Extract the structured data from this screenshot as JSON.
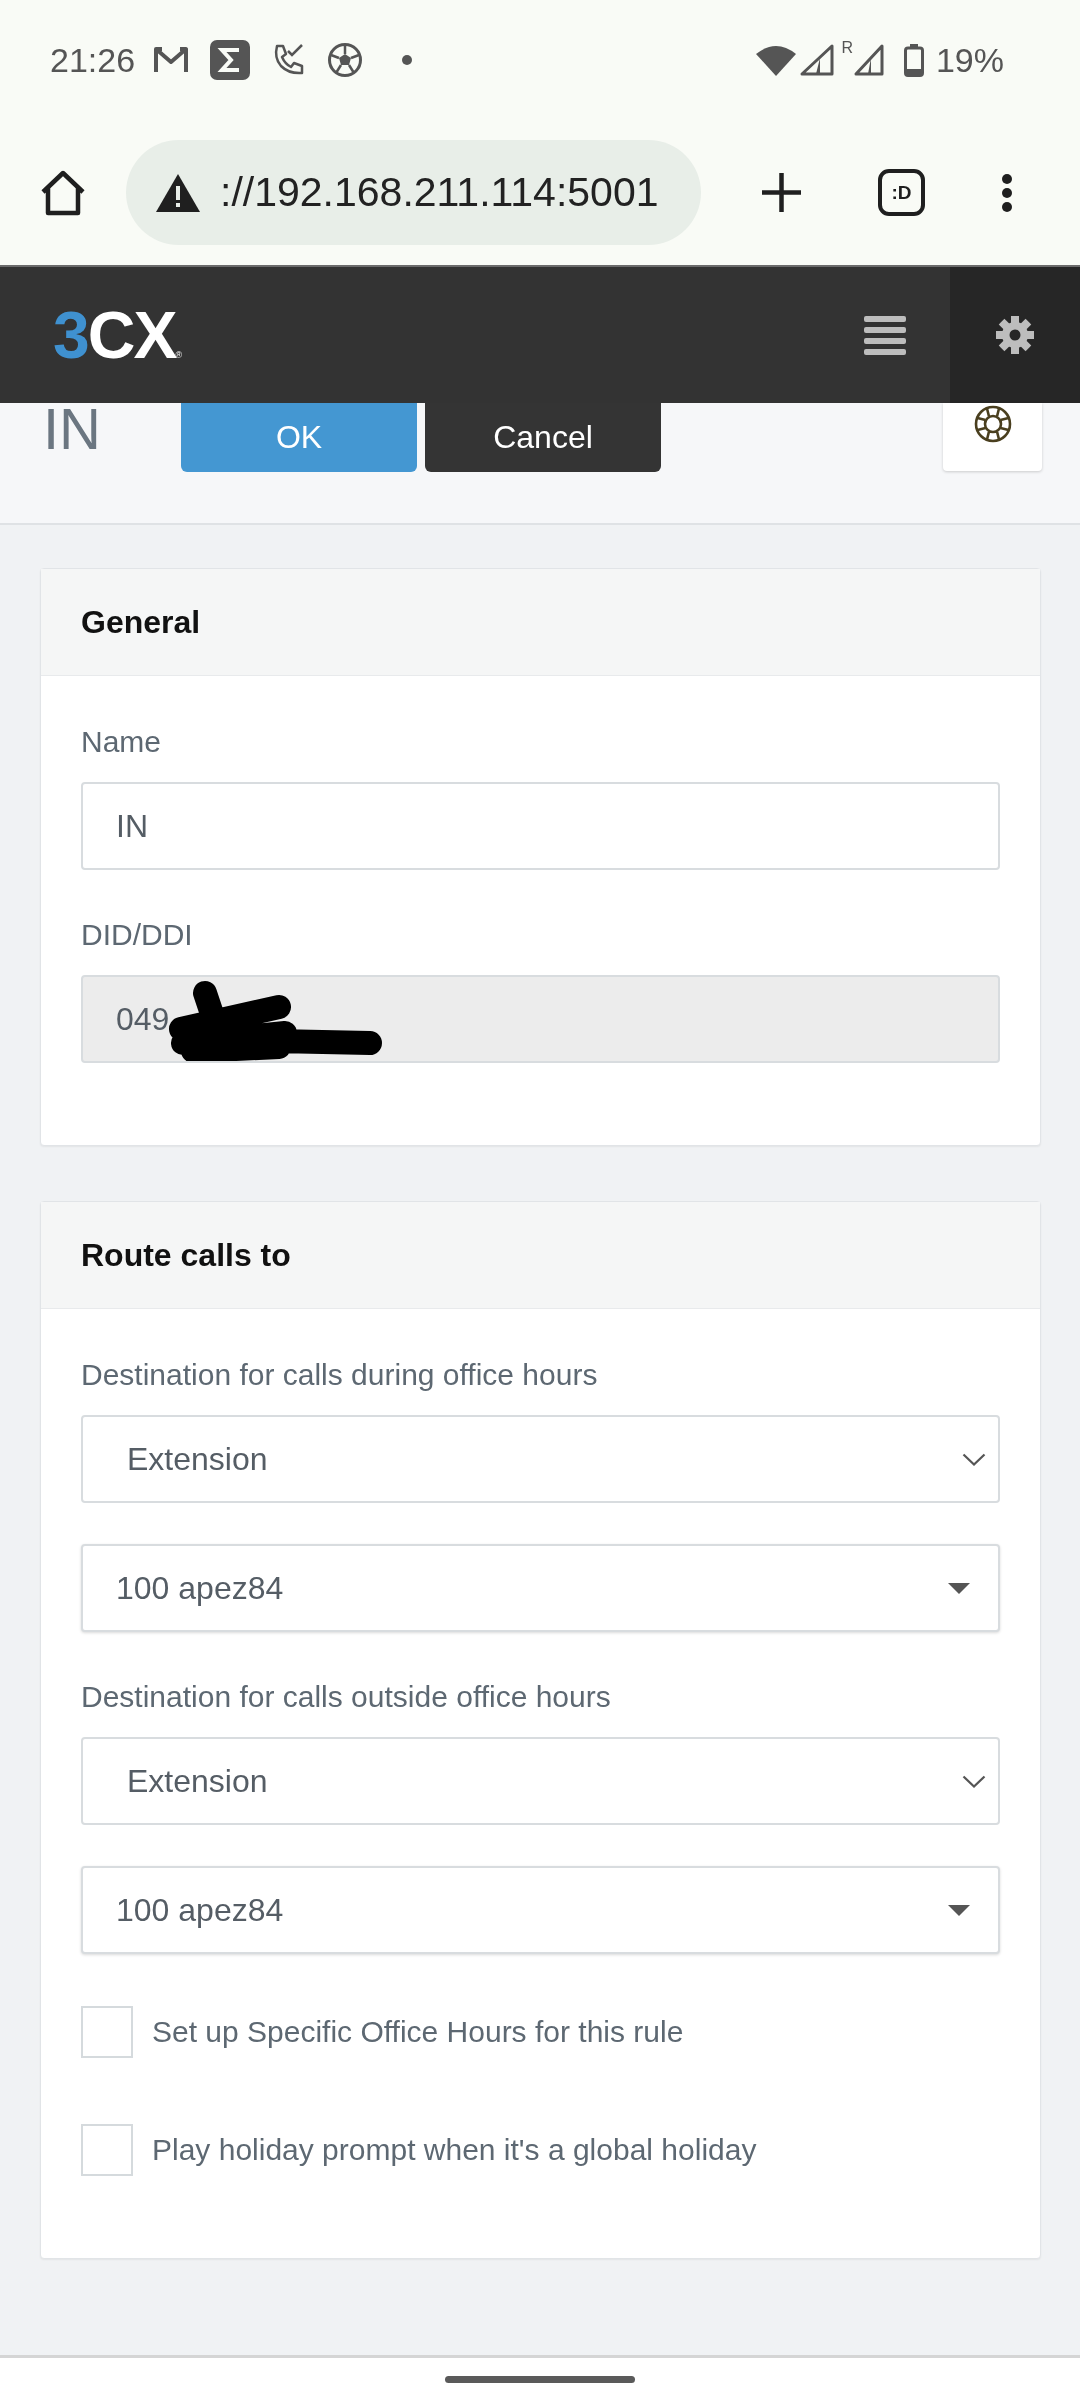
{
  "status_bar": {
    "time": "21:26",
    "roaming": "R",
    "battery": "19%"
  },
  "browser": {
    "url": "://192.168.211.114:5001",
    "tabs_label": ":D"
  },
  "app_header": {
    "logo": {
      "accent": "3",
      "text": "CX",
      "mark": "®"
    }
  },
  "toolbar": {
    "title": "IN",
    "buttons": [
      {
        "label": "OK",
        "kind": "primary"
      },
      {
        "label": "Cancel",
        "kind": "secondary"
      }
    ]
  },
  "sections": [
    {
      "title": "General",
      "fields": [
        {
          "kind": "text",
          "label": "Name",
          "value": "IN",
          "disabled": false
        },
        {
          "kind": "text",
          "label": "DID/DDI",
          "value": "049",
          "disabled": true,
          "redacted": true
        }
      ]
    },
    {
      "title": "Route calls to",
      "fields": [
        {
          "kind": "select",
          "label": "Destination for calls during office hours",
          "value": "Extension"
        },
        {
          "kind": "combo",
          "value": "100 apez84"
        },
        {
          "kind": "select",
          "label": "Destination for calls outside office hours",
          "value": "Extension"
        },
        {
          "kind": "combo",
          "value": "100 apez84"
        },
        {
          "kind": "checkbox",
          "label": "Set up Specific Office Hours for this rule",
          "checked": false
        },
        {
          "kind": "checkbox",
          "label": "Play holiday prompt when it's a global holiday",
          "checked": false
        }
      ]
    }
  ]
}
